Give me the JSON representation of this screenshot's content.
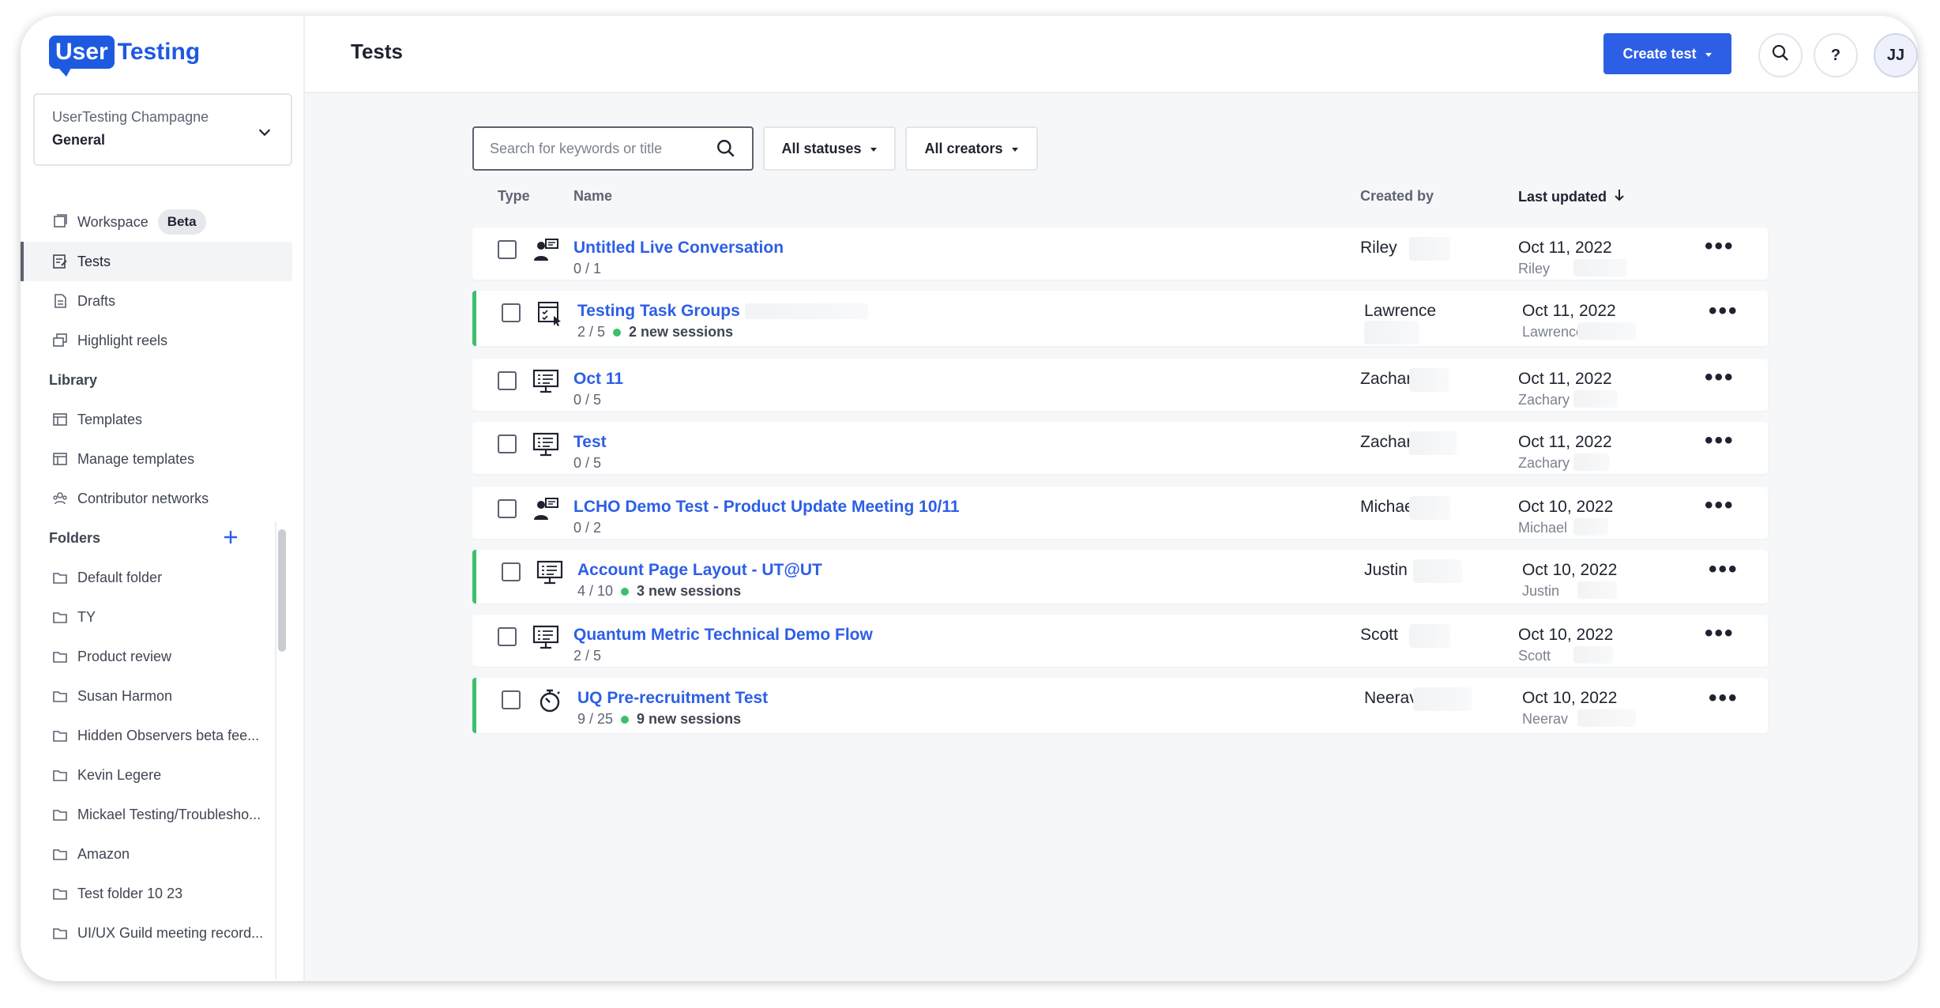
{
  "brand": {
    "logo_left": "User",
    "logo_right": "Testing",
    "color": "#1e5ae0"
  },
  "workspace": {
    "org": "UserTesting Champagne",
    "name": "General"
  },
  "nav": {
    "workspace_label": "Workspace",
    "workspace_badge": "Beta",
    "tests": "Tests",
    "drafts": "Drafts",
    "highlight_reels": "Highlight reels",
    "library_heading": "Library",
    "templates": "Templates",
    "manage_templates": "Manage templates",
    "contributor_networks": "Contributor networks",
    "folders_heading": "Folders"
  },
  "folders": [
    "Default folder",
    "TY",
    "Product review",
    "Susan Harmon",
    "Hidden Observers beta fee...",
    "Kevin Legere",
    "Mickael Testing/Troublesho...",
    "Amazon",
    "Test folder 10 23",
    "UI/UX Guild meeting record..."
  ],
  "header": {
    "title": "Tests",
    "create_label": "Create test",
    "help_label": "?",
    "avatar_initials": "JJ",
    "accent": "#2d5fe6"
  },
  "filters": {
    "search_placeholder": "Search for keywords or title",
    "status": "All statuses",
    "creators": "All creators"
  },
  "columns": {
    "type": "Type",
    "name": "Name",
    "created_by": "Created by",
    "last_updated": "Last updated"
  },
  "tests": [
    {
      "name": "Untitled Live Conversation",
      "progress": "0 / 1",
      "sessions": "",
      "creator": "Riley",
      "date": "Oct 11, 2022",
      "updated_by": "Riley",
      "icon": "live-conversation-icon"
    },
    {
      "name": "Testing Task Groups",
      "progress": "2 / 5",
      "sessions": "2 new sessions",
      "creator": "Lawrence",
      "date": "Oct 11, 2022",
      "updated_by": "Lawrence",
      "icon": "task-groups-icon"
    },
    {
      "name": "Oct 11",
      "progress": "0 / 5",
      "sessions": "",
      "creator": "Zachary",
      "date": "Oct 11, 2022",
      "updated_by": "Zachary",
      "icon": "desktop-test-icon"
    },
    {
      "name": "Test",
      "progress": "0 / 5",
      "sessions": "",
      "creator": "Zachary",
      "date": "Oct 11, 2022",
      "updated_by": "Zachary",
      "icon": "desktop-test-icon"
    },
    {
      "name": "LCHO Demo Test - Product Update Meeting 10/11",
      "progress": "0 / 2",
      "sessions": "",
      "creator": "Michael",
      "date": "Oct 10, 2022",
      "updated_by": "Michael",
      "icon": "live-conversation-icon"
    },
    {
      "name": "Account Page Layout - UT@UT",
      "progress": "4 / 10",
      "sessions": "3 new sessions",
      "creator": "Justin",
      "date": "Oct 10, 2022",
      "updated_by": "Justin",
      "icon": "desktop-test-icon"
    },
    {
      "name": "Quantum Metric Technical Demo Flow",
      "progress": "2 / 5",
      "sessions": "",
      "creator": "Scott",
      "date": "Oct 10, 2022",
      "updated_by": "Scott",
      "icon": "desktop-test-icon"
    },
    {
      "name": "UQ Pre-recruitment Test",
      "progress": "9 / 25",
      "sessions": "9 new sessions",
      "creator": "Neerav",
      "date": "Oct 10, 2022",
      "updated_by": "Neerav",
      "icon": "stopwatch-icon"
    }
  ]
}
